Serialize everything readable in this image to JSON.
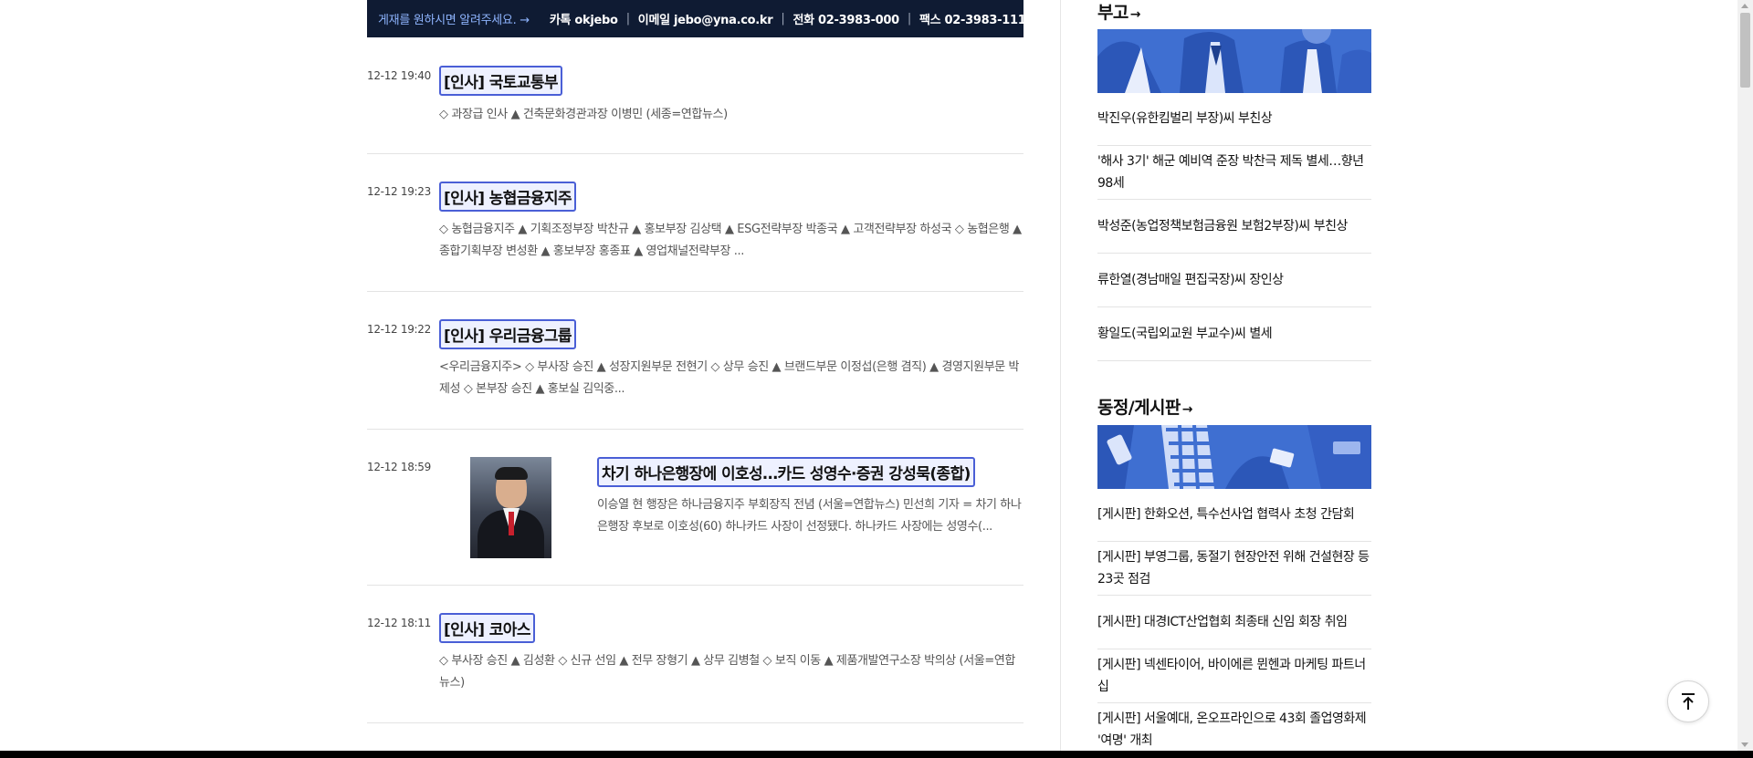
{
  "jebo_bar": {
    "link_text": "게재를 원하시면 알려주세요. →",
    "kakao": "카톡 okjebo",
    "email": "이메일 jebo@yna.co.kr",
    "phone": "전화 02-3983-000",
    "fax": "팩스 02-3983-111",
    "separator": "|"
  },
  "articles": [
    {
      "time": "12-12 19:40",
      "title": "[인사] 국토교통부",
      "summary": "◇ 과장급 인사 ▲ 건축문화경관과장 이병민 (세종=연합뉴스)"
    },
    {
      "time": "12-12 19:23",
      "title": "[인사] 농협금융지주",
      "summary": "◇ 농협금융지주 ▲ 기획조정부장 박찬규 ▲ 홍보부장 김상택 ▲ ESG전략부장 박종국 ▲ 고객전략부장 하성국 ◇ 농협은행 ▲ 종합기획부장 변성환 ▲ 홍보부장 홍종표 ▲ 영업채널전략부장 ..."
    },
    {
      "time": "12-12 19:22",
      "title": "[인사] 우리금융그룹",
      "summary": "<우리금융지주> ◇ 부사장 승진 ▲ 성장지원부문 전현기 ◇ 상무 승진 ▲ 브랜드부문 이정섭(은행 겸직) ▲ 경영지원부문 박제성 ◇ 본부장 승진 ▲ 홍보실 김익중..."
    },
    {
      "time": "12-12 18:59",
      "title": "차기 하나은행장에 이호성…카드 성영수·증권 강성묵(종합)",
      "summary": "이승열 현 행장은 하나금융지주 부회장직 전념 (서울=연합뉴스) 민선희 기자 = 차기 하나은행장 후보로 이호성(60) 하나카드 사장이 선정됐다. 하나카드 사장에는 성영수(..."
    },
    {
      "time": "12-12 18:11",
      "title": "[인사] 코아스",
      "summary": "◇ 부사장 승진 ▲ 김성환 ◇ 신규 선임 ▲ 전무 장형기 ▲ 상무 김병철 ◇ 보직 이동 ▲ 제품개발연구소장 박의상 (서울=연합뉴스)"
    }
  ],
  "sidebar": {
    "obituary": {
      "title": "부고",
      "arrow": "→",
      "items": [
        "박진우(유한킴벌리 부장)씨 부친상",
        "'해사 3기' 해군 예비역 준장 박찬극 제독 별세…향년 98세",
        "박성준(농업정책보험금융원 보험2부장)씨 부친상",
        "류한열(경남매일 편집국장)씨 장인상",
        "황일도(국립외교원 부교수)씨 별세"
      ]
    },
    "board": {
      "title": "동정/게시판",
      "arrow": "→",
      "items": [
        "[게시판] 한화오션, 특수선사업 협력사 초청 간담회",
        "[게시판] 부영그룹, 동절기 현장안전 위해 건설현장 등 23곳 점검",
        "[게시판] 대경ICT산업협회 최종태 신임 회장 취임",
        "[게시판] 넥센타이어, 바이에른 뮌헨과 마케팅 파트너십",
        "[게시판] 서울예대, 온오프라인으로 43회 졸업영화제 '여명' 개최"
      ]
    }
  },
  "icons": {
    "scroll_top": "arrow-up-to-line-icon"
  },
  "colors": {
    "banner_bg": "#0f1b33",
    "link_blue": "#8fb5ff",
    "title_highlight_border": "#4a5fd6",
    "section_image_blue": "#3f6fd1"
  }
}
